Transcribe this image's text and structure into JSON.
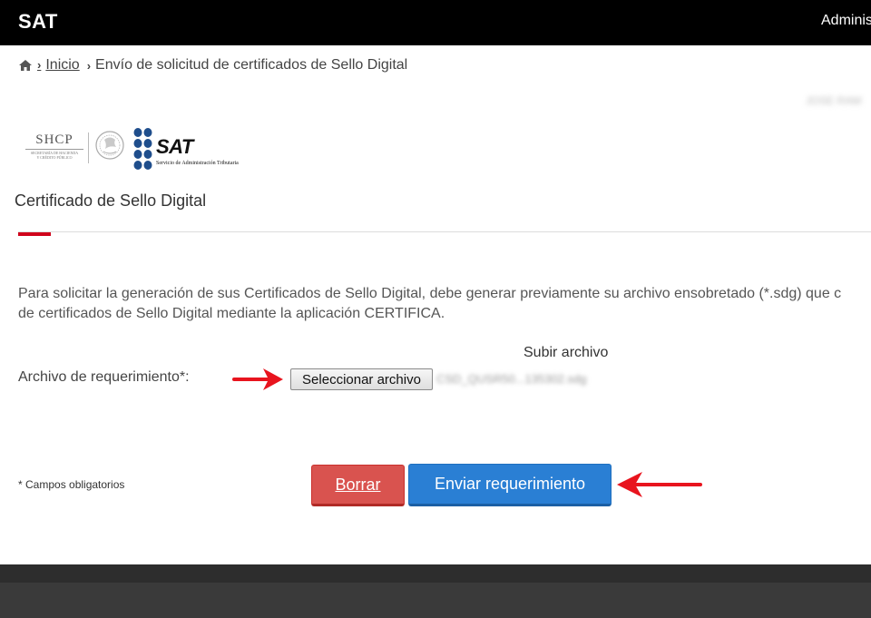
{
  "topbar": {
    "brand": "SAT",
    "right_link": "Adminis"
  },
  "breadcrumb": {
    "home_link": "Inicio",
    "current": "Envío de solicitud de certificados de Sello Digital"
  },
  "user": {
    "name": "JOSE RAM"
  },
  "logos": {
    "shcp_title": "SHCP",
    "shcp_subtitle_1": "SECRETARÍA DE HACIENDA",
    "shcp_subtitle_2": "Y CRÉDITO PÚBLICO",
    "sat_word": "SAT",
    "sat_subtitle": "Servicio de Administración Tributaria"
  },
  "section": {
    "title": "Certificado de Sello Digital"
  },
  "intro": {
    "line1": "Para solicitar la generación de sus Certificados de Sello Digital, debe generar previamente su archivo ensobretado (*.sdg) que c",
    "line2": "de certificados de Sello Digital mediante la aplicación CERTIFICA."
  },
  "upload": {
    "heading": "Subir archivo",
    "field_label": "Archivo de requerimiento*:",
    "button_label": "Seleccionar archivo",
    "file_name": "CSD_QUSR50...135302.sdg"
  },
  "form": {
    "required_note": "* Campos obligatorios",
    "clear_label": "Borrar",
    "submit_label": "Enviar requerimiento"
  },
  "colors": {
    "topbar": "#000000",
    "accent_red": "#d0021b",
    "clear_button": "#d9534f",
    "submit_button": "#2a7fd4",
    "annotation_arrow": "#e8141e",
    "footer": "#2d2d2d"
  }
}
